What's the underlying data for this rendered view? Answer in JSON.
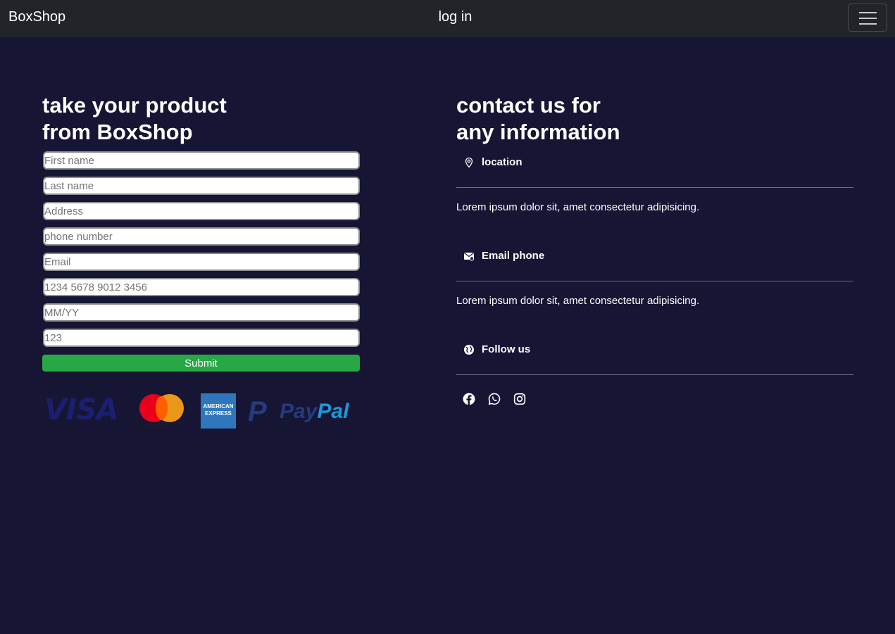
{
  "navbar": {
    "brand": "BoxShop",
    "center_link": "log in",
    "toggler_icon": "hamburger-icon"
  },
  "order_form": {
    "heading": "take your product\nfrom BoxShop",
    "fields": [
      {
        "name": "first-name-input",
        "placeholder": "First name"
      },
      {
        "name": "last-name-input",
        "placeholder": "Last name"
      },
      {
        "name": "address-input",
        "placeholder": "Address"
      },
      {
        "name": "phone-input",
        "placeholder": "phone number"
      },
      {
        "name": "email-input",
        "placeholder": "Email"
      },
      {
        "name": "card-number-input",
        "placeholder": "1234 5678 9012 3456"
      },
      {
        "name": "expiry-input",
        "placeholder": "MM/YY"
      },
      {
        "name": "cvv-input",
        "placeholder": "123"
      }
    ],
    "submit_label": "Submit",
    "payment_logos": {
      "visa": "VISA",
      "mastercard": "mastercard",
      "amex": "AMERICAN\nEXPRESS",
      "paypal_pay": "Pay",
      "paypal_pal": "Pal"
    }
  },
  "contact": {
    "heading": "contact us for\nany information",
    "location_label": "location",
    "location_text": "Lorem ipsum dolor sit, amet consectetur adipisicing.",
    "email_label": "Email phone",
    "email_text": "Lorem ipsum dolor sit, amet consectetur adipisicing.",
    "follow_label": "Follow us",
    "social_icons": [
      "facebook-icon",
      "whatsapp-icon",
      "instagram-icon"
    ]
  },
  "colors": {
    "background": "#161534",
    "navbar": "#212529",
    "submit": "#28a745"
  }
}
